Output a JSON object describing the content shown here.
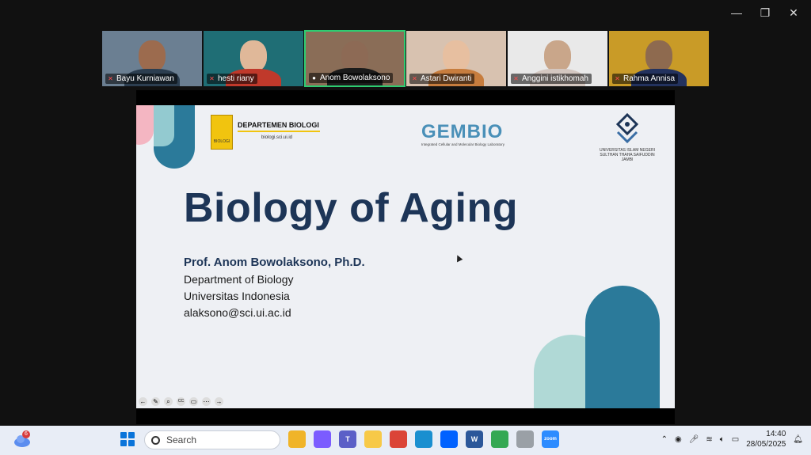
{
  "window": {
    "controls": {
      "minimize": "—",
      "restore": "❐",
      "close": "✕"
    }
  },
  "participants": [
    {
      "name": "Bayu Kurniawan",
      "bg": "#6b7f92",
      "skin": "#9c6b4e",
      "shirt": "#2c3e50"
    },
    {
      "name": "hesti riany",
      "bg": "#1f6e75",
      "skin": "#e0b899",
      "shirt": "#c0392b"
    },
    {
      "name": "Anom Bowolaksono",
      "bg": "#8a6d57",
      "skin": "#8d6a55",
      "shirt": "#1b1b1b"
    },
    {
      "name": "Astari Dwiranti",
      "bg": "#d8c2b0",
      "skin": "#e7bfa0",
      "shirt": "#c77d3e"
    },
    {
      "name": "Anggini istikhomah",
      "bg": "#e9e9e9",
      "skin": "#c9a68a",
      "shirt": "#d4c7c0"
    },
    {
      "name": "Rahma Annisa",
      "bg": "#c99b27",
      "skin": "#8e6a4f",
      "shirt": "#23325e"
    }
  ],
  "slide": {
    "dept_name": "DEPARTEMEN BIOLOGI",
    "dept_url": "biologi.sci.ui.id",
    "ui_logo_text": "BIOLOGI",
    "gembio": "GEMBIO",
    "gembio_sub": "Integrated Cellular and Molecular Biology Laboratory",
    "uin_text": "UNIVERSITAS ISLAM NEGERI SULTHAN THAHA SAIFUDDIN JAMBI",
    "title": "Biology of Aging",
    "presenter": "Prof. Anom Bowolaksono, Ph.D.",
    "department": "Department of Biology",
    "university": "Universitas Indonesia",
    "email": "alaksono@sci.ui.ac.id"
  },
  "presenter_tools": [
    "←",
    "✎",
    "⌕",
    "CC",
    "▭",
    "⋯",
    "→"
  ],
  "taskbar": {
    "weather_badge": "6",
    "search_placeholder": "Search",
    "apps": [
      {
        "name": "file-explorer",
        "color": "#f0b429",
        "label": ""
      },
      {
        "name": "copilot",
        "color": "#7b5cff",
        "label": ""
      },
      {
        "name": "teams",
        "color": "#5b5fc7",
        "label": "T"
      },
      {
        "name": "folder",
        "color": "#f7c948",
        "label": ""
      },
      {
        "name": "chrome",
        "color": "#db4437",
        "label": ""
      },
      {
        "name": "edge",
        "color": "#1a8fd0",
        "label": ""
      },
      {
        "name": "dropbox",
        "color": "#0061ff",
        "label": ""
      },
      {
        "name": "word",
        "color": "#2b579a",
        "label": "W"
      },
      {
        "name": "chrome-2",
        "color": "#34a853",
        "label": ""
      },
      {
        "name": "settings",
        "color": "#9aa0a6",
        "label": ""
      },
      {
        "name": "zoom",
        "color": "#2d8cff",
        "label": "zoom"
      }
    ],
    "time": "14:40",
    "date": "28/05/2025"
  }
}
